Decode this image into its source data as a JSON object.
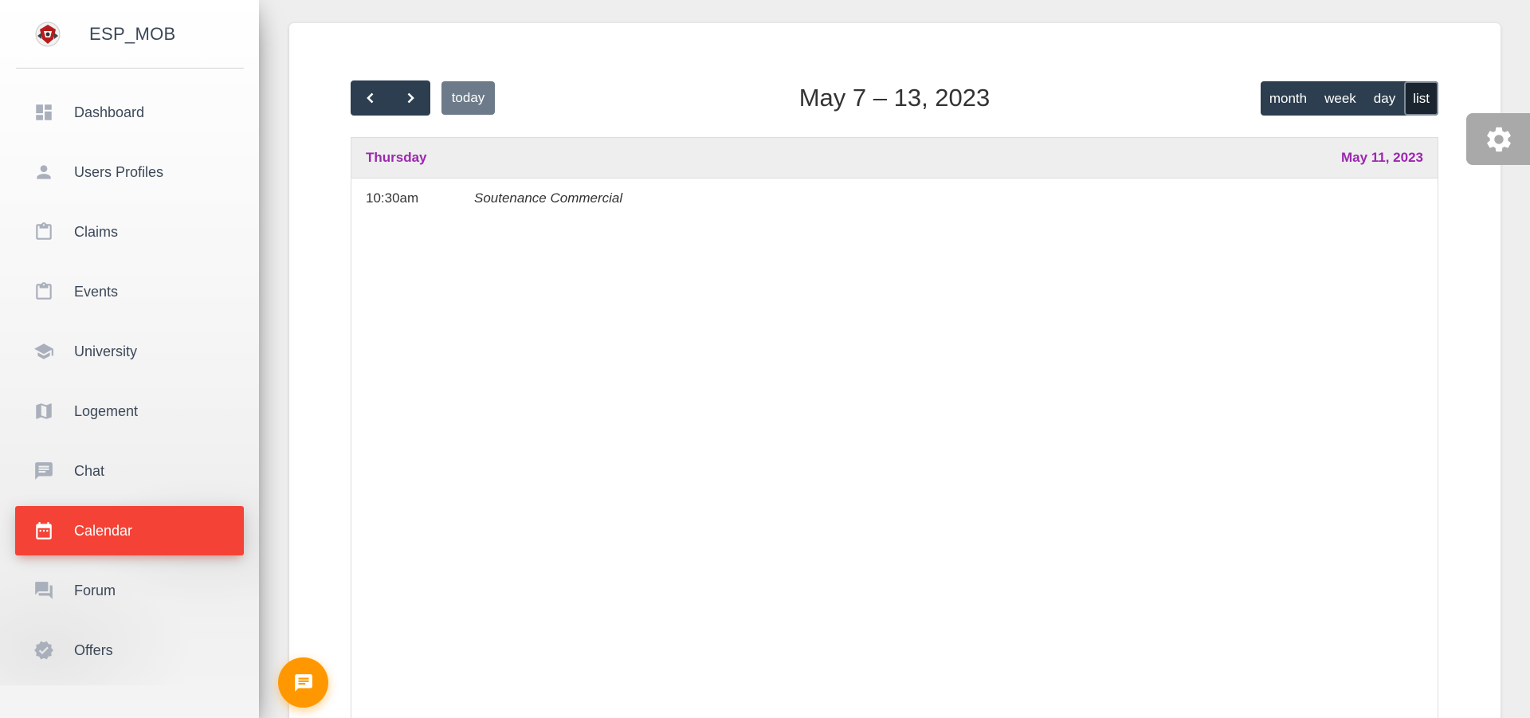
{
  "sidebar": {
    "brand": {
      "name": "ESP_MOB",
      "logo": "brand-logo"
    },
    "items": [
      {
        "label": "Dashboard",
        "icon": "dashboard-icon"
      },
      {
        "label": "Users Profiles",
        "icon": "person-icon"
      },
      {
        "label": "Claims",
        "icon": "clipboard-icon"
      },
      {
        "label": "Events",
        "icon": "clipboard-icon"
      },
      {
        "label": "University",
        "icon": "school-icon"
      },
      {
        "label": "Logement",
        "icon": "map-icon"
      },
      {
        "label": "Chat",
        "icon": "chat-icon"
      },
      {
        "label": "Calendar",
        "icon": "calendar-icon",
        "active": true
      },
      {
        "label": "Forum",
        "icon": "forum-icon"
      },
      {
        "label": "Offers",
        "icon": "verified-icon"
      }
    ],
    "active_color": "#f44336"
  },
  "calendar": {
    "prev_icon": "chevron-left-icon",
    "next_icon": "chevron-right-icon",
    "today_label": "today",
    "title": "May 7 – 13, 2023",
    "views": {
      "month": "month",
      "week": "week",
      "day": "day",
      "list": "list",
      "selected": "list"
    },
    "list": {
      "day_name": "Thursday",
      "day_date": "May 11, 2023",
      "header_color": "#9c27b0",
      "events": [
        {
          "time": "10:30am",
          "title": "Soutenance Commercial"
        }
      ]
    }
  },
  "settings": {
    "icon": "gear-icon"
  },
  "chat_fab": {
    "icon": "chat-bubble-icon",
    "color": "#ff9800"
  }
}
